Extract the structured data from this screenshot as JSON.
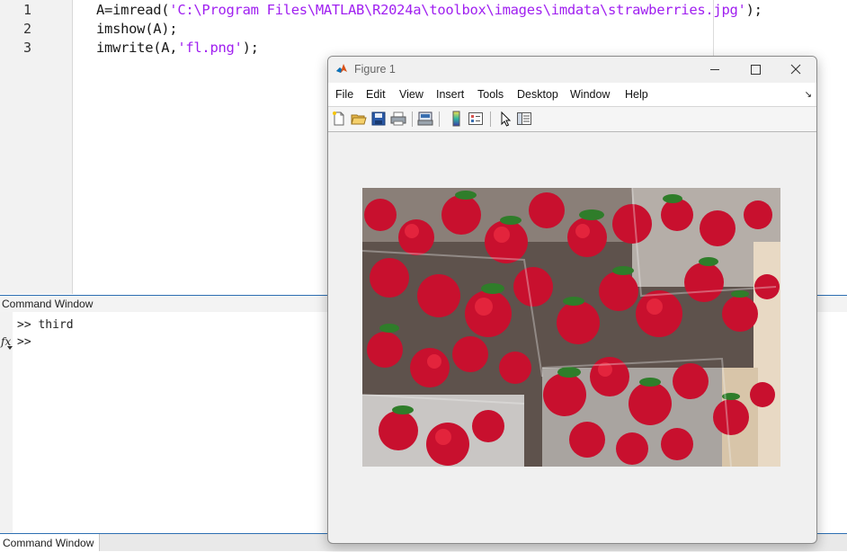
{
  "editor": {
    "line_numbers": [
      "1",
      "2",
      "3"
    ],
    "line1_prefix": "A=imread(",
    "line1_string": "'C:\\Program Files\\MATLAB\\R2024a\\toolbox\\images\\imdata\\strawberries.jpg'",
    "line1_suffix": ");",
    "line2": "imshow(A);",
    "line3_prefix": "imwrite(A,",
    "line3_string": "'fl.png'",
    "line3_suffix": ");"
  },
  "command_window": {
    "title": "Command Window",
    "line1": ">> third",
    "prompt": ">>",
    "fx_label": "fx",
    "bottom_tab_label": "Command Window"
  },
  "figure": {
    "title": "Figure 1",
    "menu": [
      "File",
      "Edit",
      "View",
      "Insert",
      "Tools",
      "Desktop",
      "Window",
      "Help"
    ],
    "menu_corner_icon": "dock-arrow-icon",
    "toolbar_icons": [
      "new-figure-icon",
      "open-file-icon",
      "save-icon",
      "print-icon",
      "print-preview-icon",
      "colorbar-icon",
      "legend-icon",
      "edit-plot-icon",
      "property-inspector-icon"
    ],
    "image_subject": "strawberries photo",
    "colors": {
      "titlebar": "#f0f0f0",
      "background": "#f0f0f0",
      "menubar": "#ffffff"
    }
  },
  "colors": {
    "string": "#a020f0",
    "accent_border": "#2d6fb2"
  }
}
